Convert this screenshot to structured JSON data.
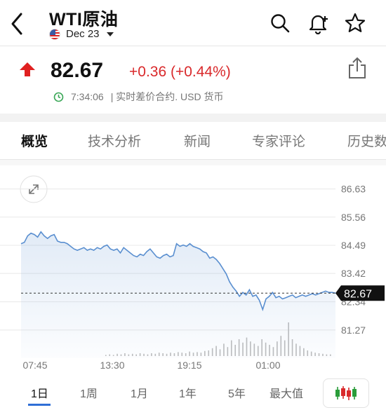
{
  "header": {
    "title": "WTI原油",
    "contract": "Dec 23",
    "flag_icon": "us-flag-icon"
  },
  "quote": {
    "price": "82.67",
    "change": "+0.36 (+0.44%)",
    "time": "7:34:06",
    "status": "| 实时差价合约. USD 货币",
    "up_color": "#e02020"
  },
  "tabs": [
    {
      "label": "概览",
      "active": true
    },
    {
      "label": "技术分析",
      "active": false
    },
    {
      "label": "新闻",
      "active": false
    },
    {
      "label": "专家评论",
      "active": false
    },
    {
      "label": "历史数",
      "active": false
    }
  ],
  "ranges": [
    {
      "label": "1日",
      "active": true
    },
    {
      "label": "1周",
      "active": false
    },
    {
      "label": "1月",
      "active": false
    },
    {
      "label": "1年",
      "active": false
    },
    {
      "label": "5年",
      "active": false
    },
    {
      "label": "最大值",
      "active": false
    }
  ],
  "chart_data": {
    "type": "line",
    "y_ticks": [
      "86.63",
      "85.56",
      "84.49",
      "83.42",
      "82.34",
      "81.27"
    ],
    "x_ticks": [
      "07:45",
      "13:30",
      "19:15",
      "01:00"
    ],
    "ylim": [
      80.2,
      87.1
    ],
    "current_value": "82.67",
    "line_color": "#5a8fd0",
    "grid": true,
    "series": [
      {
        "values": [
          84.55,
          84.6,
          84.85,
          84.95,
          84.9,
          84.8,
          85.0,
          84.85,
          84.75,
          84.85,
          84.9,
          84.65,
          84.6,
          84.6,
          84.55,
          84.45,
          84.35,
          84.3,
          84.35,
          84.4,
          84.3,
          84.35,
          84.3,
          84.4,
          84.35,
          84.45,
          84.5,
          84.35,
          84.3,
          84.35,
          84.2,
          84.4,
          84.3,
          84.2,
          84.1,
          84.05,
          84.15,
          84.1,
          84.25,
          84.35,
          84.2,
          84.05,
          84.0,
          84.1,
          84.15,
          84.05,
          84.1,
          84.55,
          84.45,
          84.5,
          84.45,
          84.55,
          84.45,
          84.4,
          84.35,
          84.25,
          84.2,
          84.0,
          84.05,
          83.95,
          83.8,
          83.6,
          83.4,
          83.1,
          82.9,
          82.75,
          82.55,
          82.7,
          82.6,
          82.8,
          82.55,
          82.6,
          82.4,
          82.05,
          82.45,
          82.55,
          82.7,
          82.5,
          82.55,
          82.45,
          82.5,
          82.55,
          82.6,
          82.5,
          82.55,
          82.6,
          82.55,
          82.6,
          82.65,
          82.6,
          82.65,
          82.7,
          82.75,
          82.7,
          82.7,
          82.67
        ]
      }
    ],
    "volume": [
      0.02,
      0.03,
      0.02,
      0.04,
      0.03,
      0.05,
      0.03,
      0.04,
      0.03,
      0.05,
      0.04,
      0.03,
      0.05,
      0.04,
      0.06,
      0.05,
      0.04,
      0.06,
      0.05,
      0.07,
      0.06,
      0.05,
      0.08,
      0.06,
      0.07,
      0.06,
      0.09,
      0.1,
      0.14,
      0.18,
      0.12,
      0.22,
      0.16,
      0.28,
      0.2,
      0.3,
      0.24,
      0.33,
      0.26,
      0.22,
      0.18,
      0.3,
      0.24,
      0.2,
      0.16,
      0.26,
      0.36,
      0.28,
      0.6,
      0.3,
      0.22,
      0.18,
      0.14,
      0.1,
      0.08,
      0.06,
      0.05,
      0.04,
      0.03,
      0.03
    ]
  }
}
